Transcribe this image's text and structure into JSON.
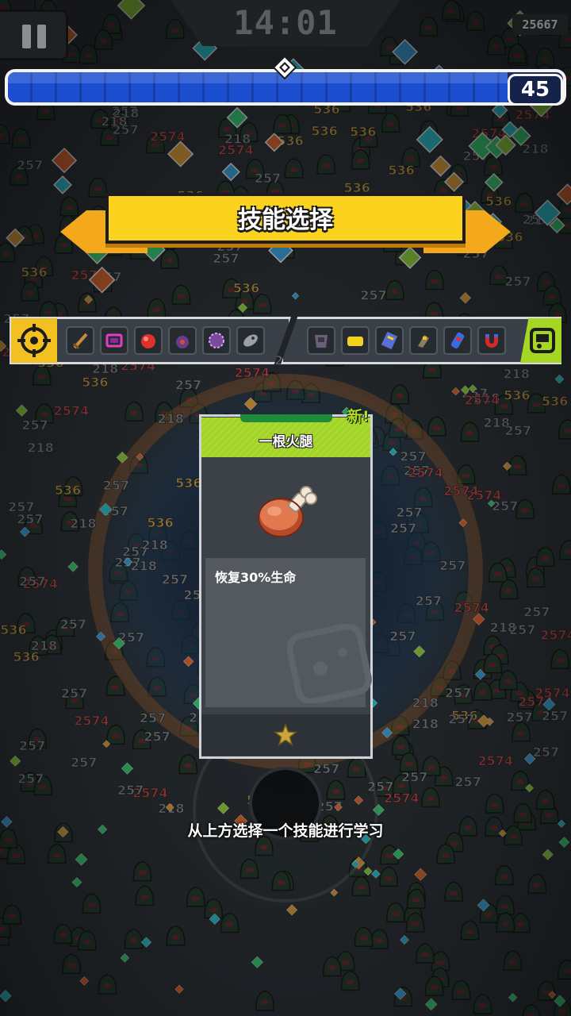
{
  "hud": {
    "timer": "14:01",
    "score": "25667",
    "level": "45",
    "xp_progress": 0.9
  },
  "banner": {
    "title": "技能选择"
  },
  "skill_bar": {
    "weapon_icons": [
      "sword-icon",
      "drone-icon",
      "fist-icon",
      "bomb-icon",
      "gear-saw-icon",
      "rocket-icon"
    ],
    "passive_icons": [
      "armor-icon",
      "yellow-block-icon",
      "book-icon",
      "boots-icon",
      "energy-drink-icon",
      "magnet-icon"
    ]
  },
  "card": {
    "new_label": "新!",
    "title": "一根火腿",
    "description": "恢复30%生命",
    "icon": "ham-icon"
  },
  "hint": "从上方选择一个技能进行学习",
  "bg_numbers": [
    "257",
    "218",
    "536",
    "257",
    "2574"
  ]
}
